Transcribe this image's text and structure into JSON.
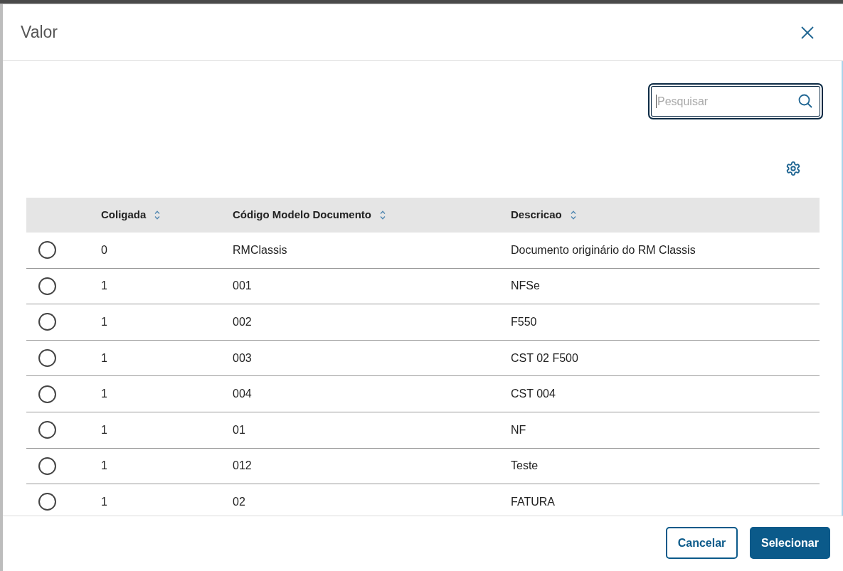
{
  "dialog": {
    "title": "Valor"
  },
  "search": {
    "placeholder": "Pesquisar",
    "focused": true
  },
  "table": {
    "columns": [
      {
        "label": "Coligada",
        "sortable": true
      },
      {
        "label": "Código Modelo Documento",
        "sortable": true
      },
      {
        "label": "Descricao",
        "sortable": true
      }
    ],
    "rows": [
      {
        "selected": false,
        "cells": [
          "0",
          "RMClassis",
          "Documento originário do RM Classis"
        ]
      },
      {
        "selected": false,
        "cells": [
          "1",
          "001",
          "NFSe"
        ]
      },
      {
        "selected": false,
        "cells": [
          "1",
          "002",
          "F550"
        ]
      },
      {
        "selected": false,
        "cells": [
          "1",
          "003",
          "CST 02 F500"
        ]
      },
      {
        "selected": false,
        "cells": [
          "1",
          "004",
          "CST 004"
        ]
      },
      {
        "selected": false,
        "cells": [
          "1",
          "01",
          "NF"
        ]
      },
      {
        "selected": false,
        "cells": [
          "1",
          "012",
          "Teste"
        ]
      },
      {
        "selected": false,
        "cells": [
          "1",
          "02",
          "FATURA"
        ]
      }
    ]
  },
  "buttons": [
    {
      "label": "Cancelar",
      "kind": "secondary"
    },
    {
      "label": "Selecionar",
      "kind": "primary"
    }
  ]
}
